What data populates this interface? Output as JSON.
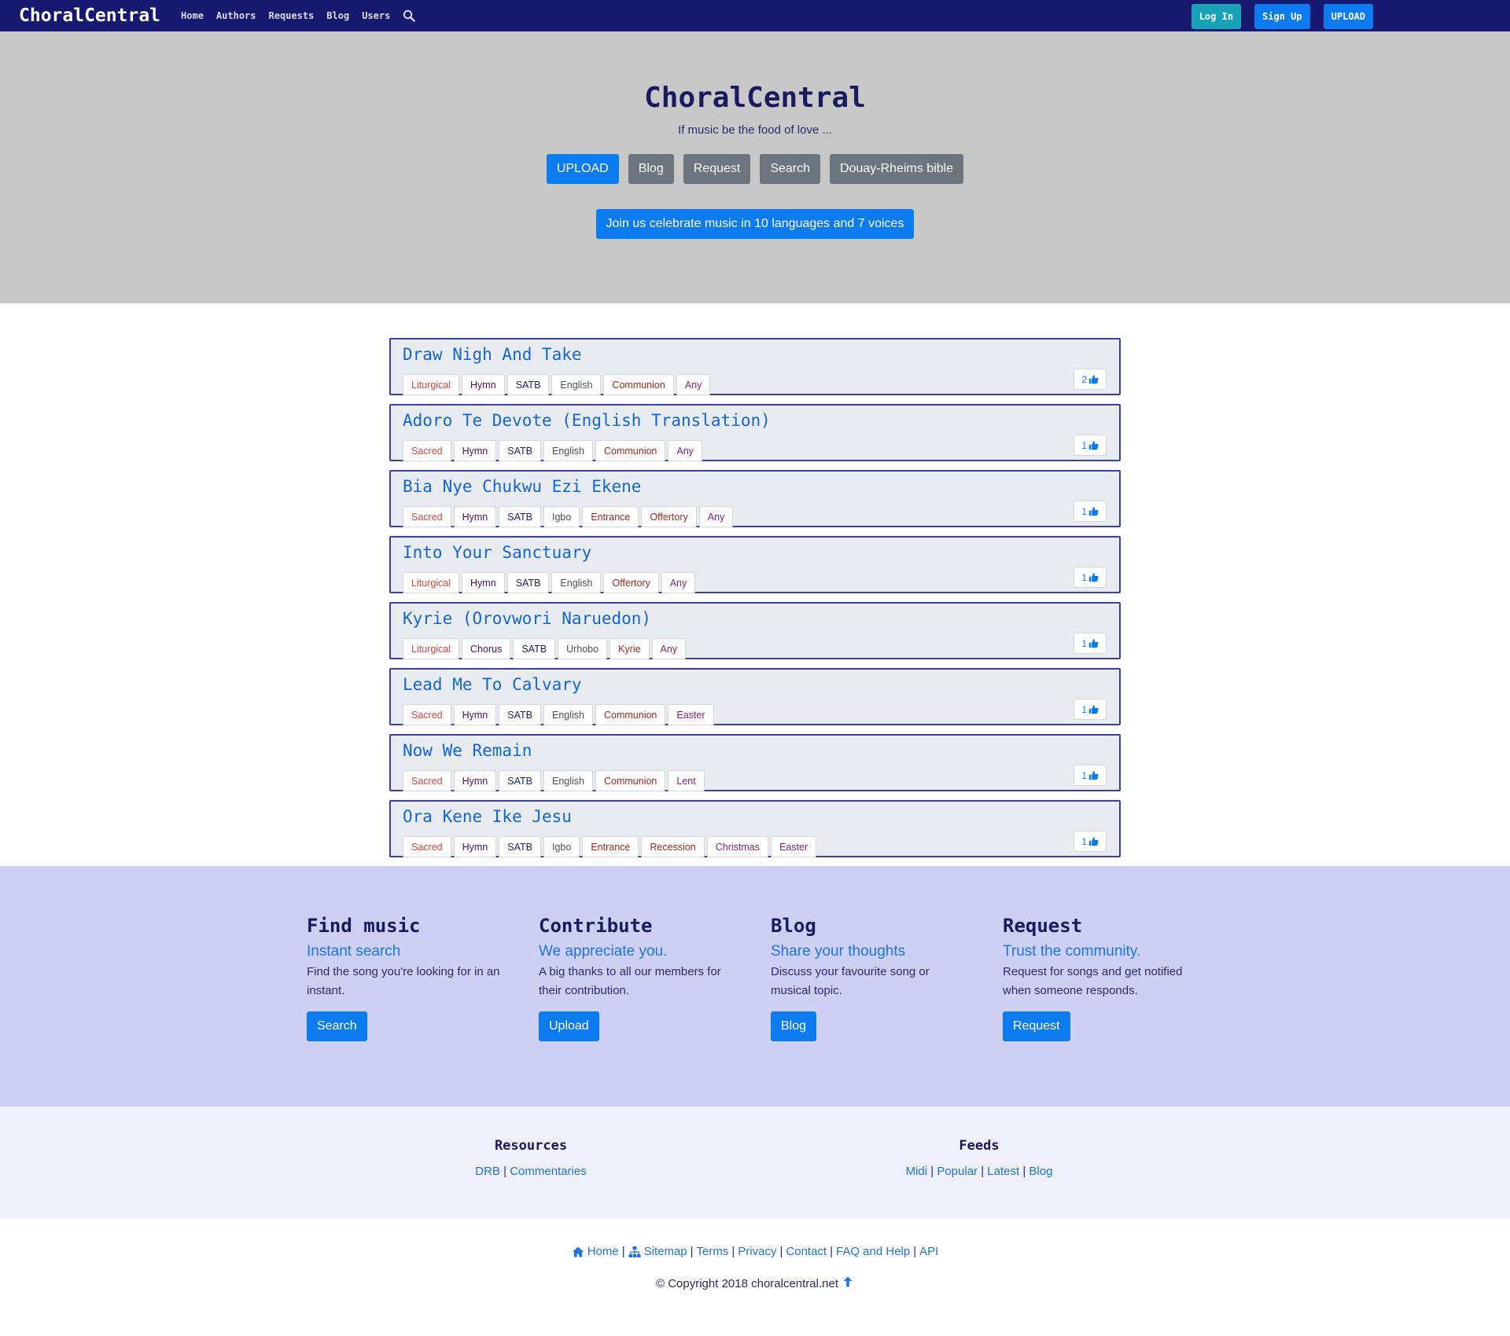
{
  "navbar": {
    "brand": "ChoralCentral",
    "links": [
      "Home",
      "Authors",
      "Requests",
      "Blog",
      "Users"
    ],
    "login": "Log In",
    "signup": "Sign Up",
    "upload": "UPLOAD"
  },
  "hero": {
    "title": "ChoralCentral",
    "tagline": "If music be the food of love ...",
    "buttons": [
      "UPLOAD",
      "Blog",
      "Request",
      "Search",
      "Douay-Rheims bible"
    ],
    "join": "Join us celebrate music in 10 languages and 7 voices"
  },
  "songs": [
    {
      "title": "Draw Nigh And Take",
      "tags": [
        "Liturgical",
        "Hymn",
        "SATB",
        "English",
        "Communion",
        "Any"
      ],
      "likes": "2"
    },
    {
      "title": "Adoro Te Devote (English Translation)",
      "tags": [
        "Sacred",
        "Hymn",
        "SATB",
        "English",
        "Communion",
        "Any"
      ],
      "likes": "1"
    },
    {
      "title": "Bia Nye Chukwu Ezi Ekene",
      "tags": [
        "Sacred",
        "Hymn",
        "SATB",
        "Igbo",
        "Entrance",
        "Offertory",
        "Any"
      ],
      "likes": "1"
    },
    {
      "title": "Into Your Sanctuary",
      "tags": [
        "Liturgical",
        "Hymn",
        "SATB",
        "English",
        "Offertory",
        "Any"
      ],
      "likes": "1"
    },
    {
      "title": "Kyrie (Orovwori Naruedon)",
      "tags": [
        "Liturgical",
        "Chorus",
        "SATB",
        "Urhobo",
        "Kyrie",
        "Any"
      ],
      "likes": "1"
    },
    {
      "title": "Lead Me To Calvary",
      "tags": [
        "Sacred",
        "Hymn",
        "SATB",
        "English",
        "Communion",
        "Easter"
      ],
      "likes": "1"
    },
    {
      "title": "Now We Remain",
      "tags": [
        "Sacred",
        "Hymn",
        "SATB",
        "English",
        "Communion",
        "Lent"
      ],
      "likes": "1"
    },
    {
      "title": "Ora Kene Ike Jesu",
      "tags": [
        "Sacred",
        "Hymn",
        "SATB",
        "Igbo",
        "Entrance",
        "Recession",
        "Christmas",
        "Easter"
      ],
      "likes": "1"
    }
  ],
  "features": [
    {
      "heading": "Find music",
      "subheading": "Instant search",
      "text": "Find the song you're looking for in an instant.",
      "button": "Search"
    },
    {
      "heading": "Contribute",
      "subheading": "We appreciate you.",
      "text": "A big thanks to all our members for their contribution.",
      "button": "Upload"
    },
    {
      "heading": "Blog",
      "subheading": "Share your thoughts",
      "text": "Discuss your favourite song or musical topic.",
      "button": "Blog"
    },
    {
      "heading": "Request",
      "subheading": "Trust the community.",
      "text": "Request for songs and get notified when someone responds.",
      "button": "Request"
    }
  ],
  "resources": {
    "title": "Resources",
    "links": [
      "DRB",
      "Commentaries"
    ]
  },
  "feeds": {
    "title": "Feeds",
    "links": [
      "Midi",
      "Popular",
      "Latest",
      "Blog"
    ]
  },
  "footer": {
    "links": [
      "Home",
      "Sitemap",
      "Terms",
      "Privacy",
      "Contact",
      "FAQ and Help",
      "API"
    ],
    "copyright": "© Copyright 2018 choralcentral.net"
  },
  "colors": {
    "navbar": "#171870",
    "hero": "#c8c8c8",
    "primary": "#0d7bf0",
    "secondary": "#6c757d",
    "features_bg": "#cdd0f3",
    "resources_bg": "#eff0fa"
  }
}
